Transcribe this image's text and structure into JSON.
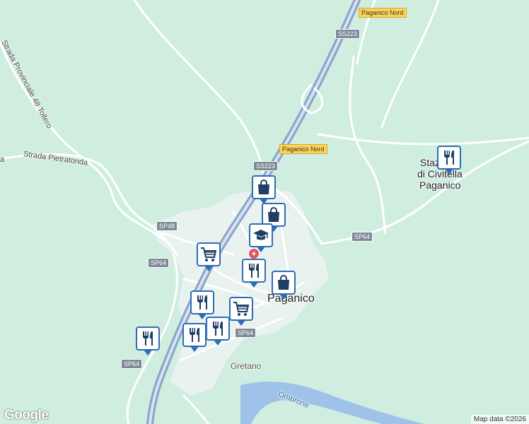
{
  "roads": {
    "sp_provinciale_48": "Strada Provinciale 48 Tollero",
    "strada_pietratonda": "Strada Pietratonda",
    "left_edge_fragment": "a"
  },
  "shields": {
    "ss223_top": "SS223",
    "ss223_mid": "SS223",
    "sp48": "SP48",
    "sp64_left": "SP64",
    "sp64_right": "SP64",
    "sp64_center": "SP64",
    "sp64_bottom": "SP64"
  },
  "exits": {
    "paganico_nord_top": "Paganico Nord",
    "paganico_nord_mid": "Paganico Nord"
  },
  "places": {
    "paganico": "Paganico",
    "stazione_line1": "Stazione",
    "stazione_line2": "di Civitella",
    "stazione_line3": "Paganico",
    "gretano": "Gretano",
    "ombrone": "Ombrone"
  },
  "pins": [
    {
      "type": "shopping-bag-icon"
    },
    {
      "type": "shopping-bag-icon"
    },
    {
      "type": "school-icon"
    },
    {
      "type": "shopping-cart-icon"
    },
    {
      "type": "restaurant-icon"
    },
    {
      "type": "shopping-bag-icon"
    },
    {
      "type": "restaurant-icon"
    },
    {
      "type": "shopping-cart-icon"
    },
    {
      "type": "restaurant-icon"
    },
    {
      "type": "restaurant-icon"
    },
    {
      "type": "restaurant-icon"
    },
    {
      "type": "restaurant-icon"
    }
  ],
  "branding": {
    "logo": "Google",
    "attribution": "Map data ©2026"
  },
  "colors": {
    "land": "#cfeee0",
    "urban": "#eaf2ef",
    "road": "#ffffff",
    "highway": "#8aa3c7",
    "water": "#9fc3e8",
    "pin_border": "#2c6db5",
    "pin_icon": "#1f3f66"
  }
}
